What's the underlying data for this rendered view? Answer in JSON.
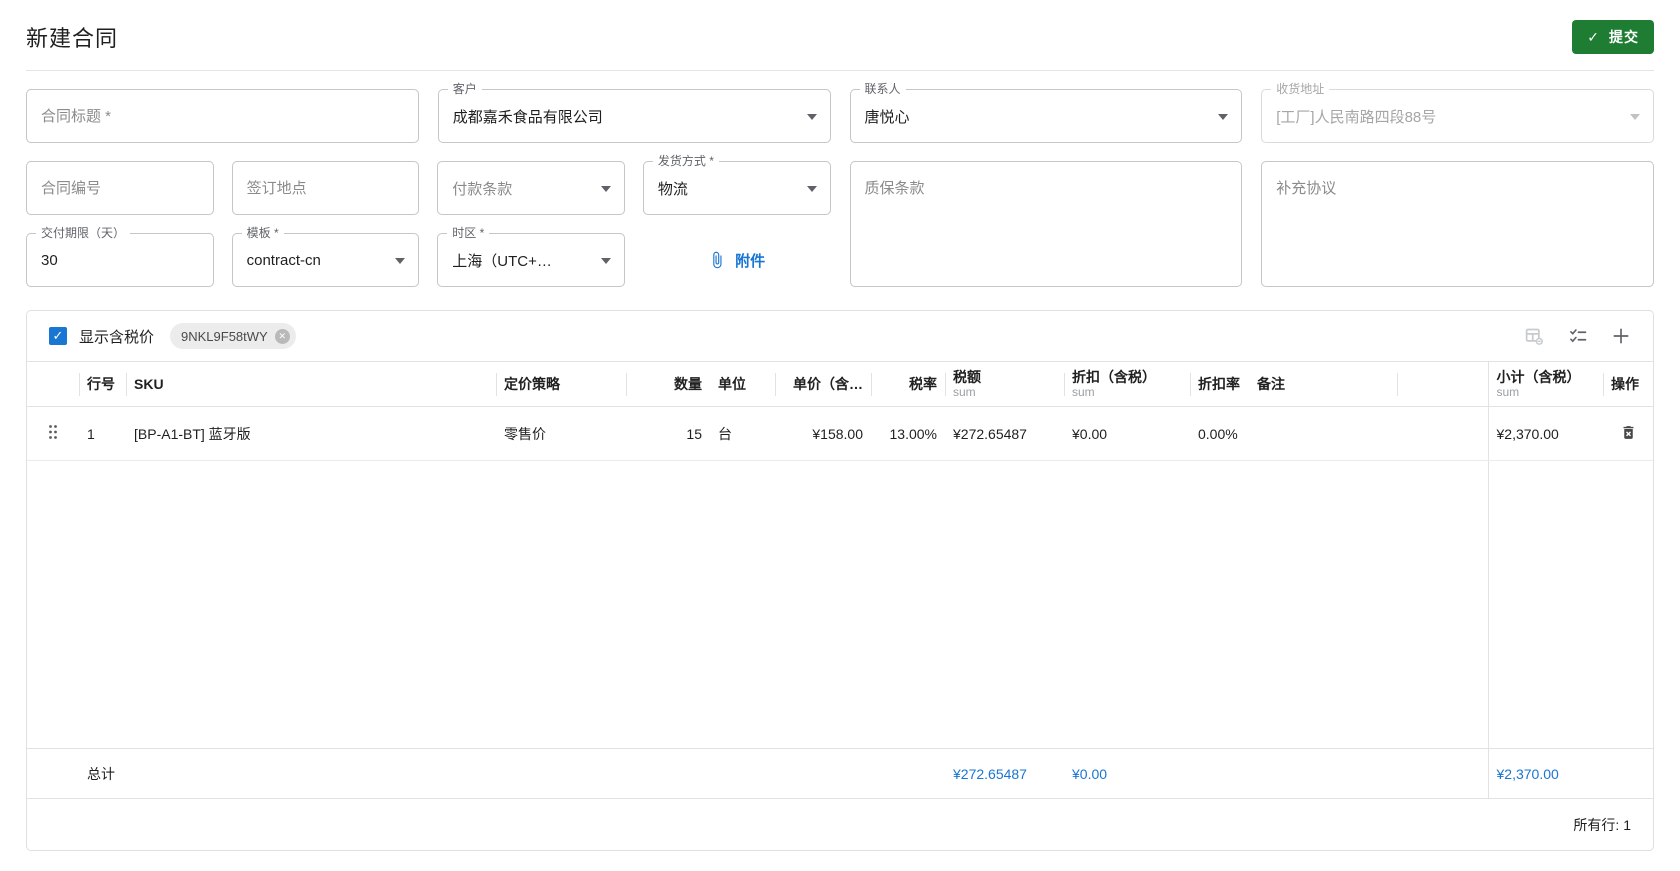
{
  "colors": {
    "accent_blue": "#1976d2",
    "submit_green": "#1e7d33"
  },
  "header": {
    "title": "新建合同",
    "submit_label": "提交"
  },
  "form": {
    "contract_title": {
      "placeholder": "合同标题 *"
    },
    "customer": {
      "label": "客户",
      "value": "成都嘉禾食品有限公司"
    },
    "contact": {
      "label": "联系人",
      "value": "唐悦心"
    },
    "shipping_address": {
      "label": "收货地址",
      "value": "[工厂]人民南路四段88号"
    },
    "contract_no": {
      "placeholder": "合同编号"
    },
    "signing_place": {
      "placeholder": "签订地点"
    },
    "payment_terms": {
      "placeholder": "付款条款"
    },
    "shipping_method": {
      "label": "发货方式 *",
      "value": "物流"
    },
    "warranty_terms": {
      "placeholder": "质保条款"
    },
    "supplementary_agreement": {
      "placeholder": "补充协议"
    },
    "delivery_days": {
      "label": "交付期限（天）",
      "value": "30"
    },
    "template": {
      "label": "模板 *",
      "value": "contract-cn"
    },
    "timezone": {
      "label": "时区 *",
      "value": "上海（UTC+…"
    },
    "attachment_label": "附件"
  },
  "grid": {
    "show_tax_label": "显示含税价",
    "tag": "9NKL9F58tWY",
    "columns": [
      {
        "label": "行号"
      },
      {
        "label": "SKU"
      },
      {
        "label": "定价策略"
      },
      {
        "label": "数量"
      },
      {
        "label": "单位"
      },
      {
        "label": "单价（含…"
      },
      {
        "label": "税率"
      },
      {
        "label": "税额",
        "sub": "sum"
      },
      {
        "label": "折扣（含税）",
        "sub": "sum"
      },
      {
        "label": "折扣率"
      },
      {
        "label": "备注"
      },
      {
        "label": "小计（含税）",
        "sub": "sum"
      },
      {
        "label": "操作"
      }
    ],
    "rows": [
      {
        "line_no": "1",
        "sku": "[BP-A1-BT] 蓝牙版",
        "pricing_strategy": "零售价",
        "qty": "15",
        "unit": "台",
        "unit_price": "¥158.00",
        "tax_rate": "13.00%",
        "tax_amount": "¥272.65487",
        "discount": "¥0.00",
        "discount_rate": "0.00%",
        "remark": "",
        "subtotal": "¥2,370.00"
      }
    ],
    "totals": {
      "label": "总计",
      "tax_amount": "¥272.65487",
      "discount": "¥0.00",
      "subtotal": "¥2,370.00"
    },
    "footer": {
      "all_rows": "所有行: 1"
    }
  }
}
